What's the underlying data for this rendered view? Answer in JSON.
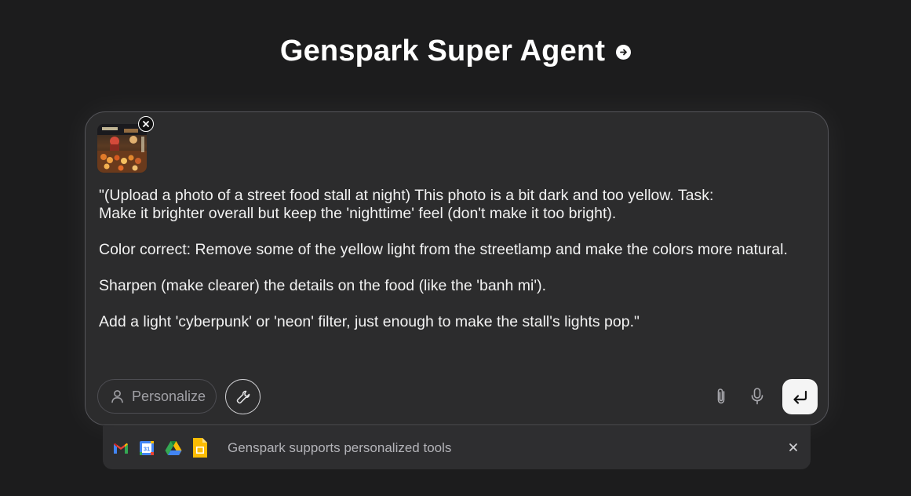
{
  "header": {
    "title": "Genspark Super Agent"
  },
  "composer": {
    "prompt_lines": [
      "\"(Upload a photo of a street food stall at night) This photo is a bit dark and too yellow. Task:",
      "Make it brighter overall but keep the 'nighttime' feel (don't make it too bright).",
      "Color correct: Remove some of the yellow light from the streetlamp and make the colors more natural.",
      "Sharpen (make clearer) the details on the food (like the 'banh mi').",
      "Add a light 'cyberpunk' or 'neon' filter, just enough to make the stall's lights pop.\""
    ],
    "personalize_label": "Personalize",
    "icons": {
      "personalize": "person-icon",
      "tools": "wrench-icon",
      "attach": "paperclip-icon",
      "mic": "microphone-icon",
      "send": "enter-arrow-icon",
      "remove_attachment": "close-icon"
    }
  },
  "tools_bar": {
    "text": "Genspark supports personalized tools",
    "apps": [
      "gmail-icon",
      "google-calendar-icon",
      "google-drive-icon",
      "google-sheets-icon"
    ]
  },
  "colors": {
    "background": "#1c1c1d",
    "composer_bg": "#2c2c2d",
    "send_button": "#f5f5f5"
  }
}
